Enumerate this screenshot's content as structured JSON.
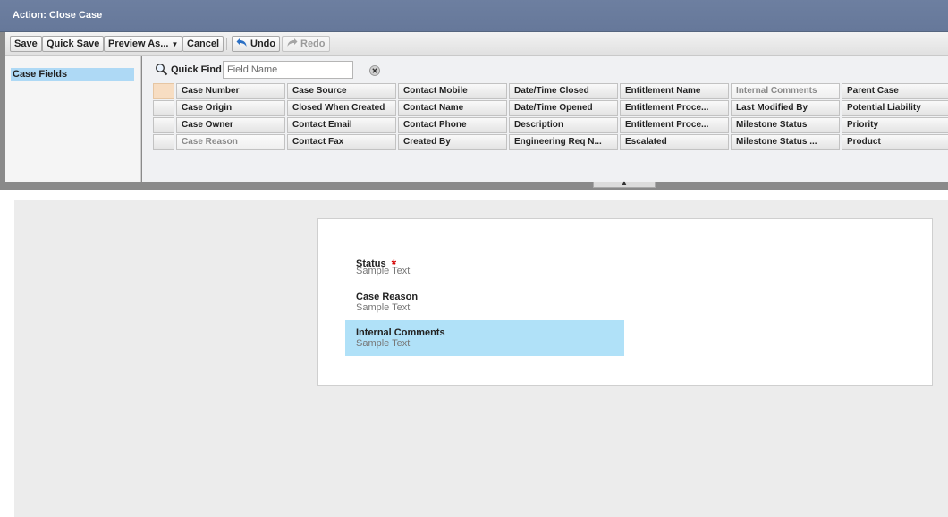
{
  "window": {
    "title": "Action: Close Case"
  },
  "toolbar": {
    "save": "Save",
    "quick_save": "Quick Save",
    "preview_as": "Preview As...",
    "cancel": "Cancel",
    "undo": "Undo",
    "redo": "Redo"
  },
  "palette": {
    "categories": [
      {
        "label": "Case Fields",
        "selected": true
      }
    ],
    "quick_find": {
      "label": "Quick Find",
      "placeholder": "Field Name",
      "value": ""
    },
    "fields": [
      [
        "Case Number",
        "Case Source",
        "Contact Mobile",
        "Date/Time Closed",
        "Entitlement Name",
        "Internal Comments",
        "Parent Case"
      ],
      [
        "Case Origin",
        "Closed When Created",
        "Contact Name",
        "Date/Time Opened",
        "Entitlement Proce...",
        "Last Modified By",
        "Potential Liability"
      ],
      [
        "Case Owner",
        "Contact Email",
        "Contact Phone",
        "Description",
        "Entitlement Proce...",
        "Milestone Status",
        "Priority"
      ],
      [
        "Case Reason",
        "Contact Fax",
        "Created By",
        "Engineering Req N...",
        "Escalated",
        "Milestone Status ...",
        "Product"
      ]
    ],
    "used_fields": [
      "Case Reason",
      "Internal Comments"
    ]
  },
  "layout": {
    "fields": [
      {
        "label": "Status",
        "required": true,
        "sample": "Sample Text",
        "highlighted": false
      },
      {
        "label": "Case Reason",
        "required": false,
        "sample": "Sample Text",
        "highlighted": false
      },
      {
        "label": "Internal Comments",
        "required": false,
        "sample": "Sample Text",
        "highlighted": true
      }
    ],
    "required_marker": "*"
  },
  "colors": {
    "title_bar": "#6d7fa0",
    "selected_category": "#aed9f5",
    "highlight": "#b0e1f8",
    "required": "#d40000"
  }
}
